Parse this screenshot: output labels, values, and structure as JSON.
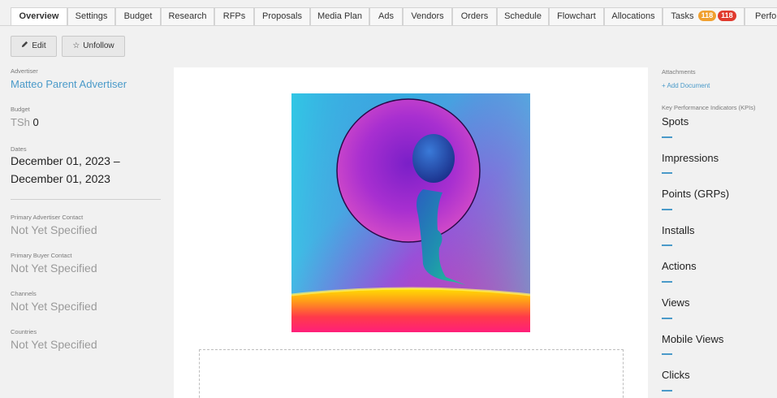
{
  "tabs": [
    {
      "label": "Overview",
      "active": true
    },
    {
      "label": "Settings"
    },
    {
      "label": "Budget"
    },
    {
      "label": "Research"
    },
    {
      "label": "RFPs"
    },
    {
      "label": "Proposals"
    },
    {
      "label": "Media Plan"
    },
    {
      "label": "Ads"
    },
    {
      "label": "Vendors"
    },
    {
      "label": "Orders"
    },
    {
      "label": "Schedule"
    },
    {
      "label": "Flowchart"
    },
    {
      "label": "Allocations"
    },
    {
      "label": "Tasks",
      "badges": [
        {
          "count": "118",
          "color": "#f0a030"
        },
        {
          "count": "118",
          "color": "#e03a2e"
        }
      ]
    },
    {
      "label": "Perfo"
    }
  ],
  "actions": {
    "edit_label": "Edit",
    "unfollow_label": "Unfollow"
  },
  "details": {
    "advertiser_label": "Advertiser",
    "advertiser_value": "Matteo Parent Advertiser",
    "budget_label": "Budget",
    "budget_currency": "TSh",
    "budget_value": "0",
    "dates_label": "Dates",
    "dates_line1": "December 01, 2023 –",
    "dates_line2": "December 01, 2023",
    "primary_advertiser_contact_label": "Primary Advertiser Contact",
    "primary_advertiser_contact_value": "Not Yet Specified",
    "primary_buyer_contact_label": "Primary Buyer Contact",
    "primary_buyer_contact_value": "Not Yet Specified",
    "channels_label": "Channels",
    "channels_value": "Not Yet Specified",
    "countries_label": "Countries",
    "countries_value": "Not Yet Specified"
  },
  "attachments": {
    "label": "Attachments",
    "add_document": "Add Document"
  },
  "kpis": {
    "label": "Key Performance Indicators (KPIs)",
    "items": [
      "Spots",
      "Impressions",
      "Points (GRPs)",
      "Installs",
      "Actions",
      "Views",
      "Mobile Views",
      "Clicks"
    ]
  },
  "colors": {
    "accent": "#4a9ac9",
    "badge_orange": "#f0a030",
    "badge_red": "#e03a2e"
  }
}
